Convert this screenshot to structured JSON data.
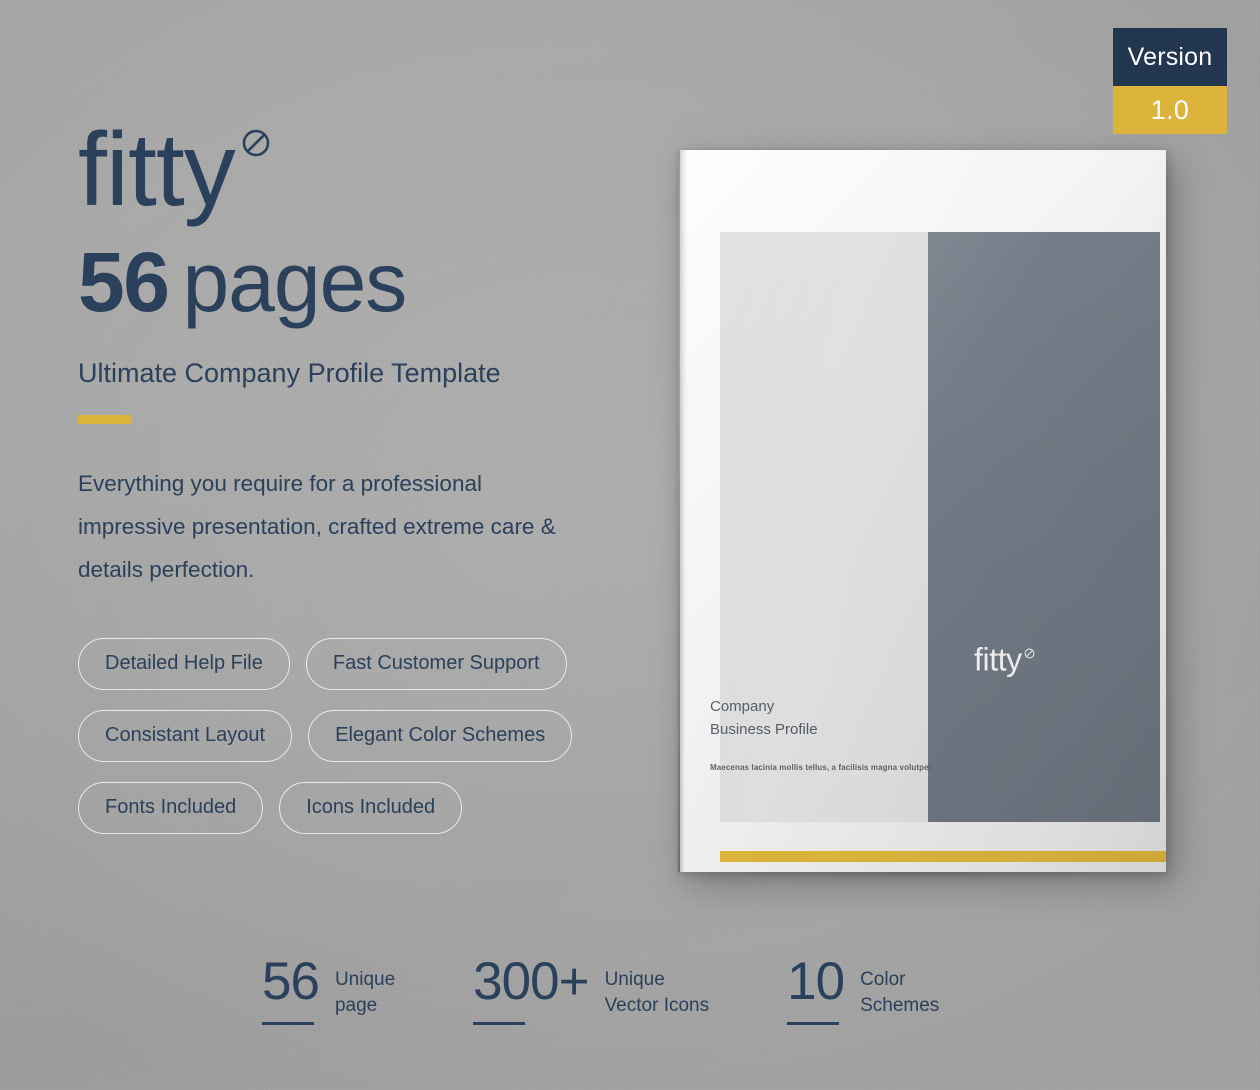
{
  "version_badge": {
    "label": "Version",
    "value": "1.0",
    "top_color": "#23364f",
    "bottom_color": "#dcb43c"
  },
  "brand": {
    "name": "fitty",
    "mark": "circle-slash-icon"
  },
  "headline": {
    "number": "56",
    "word": "pages"
  },
  "subtitle": "Ultimate Company Profile Template",
  "accent_color": "#dcb43c",
  "description": "Everything you require for a professional impressive presentation, crafted extreme care & details perfection.",
  "features": [
    "Detailed Help File",
    "Fast Customer Support",
    "Consistant Layout",
    "Elegant Color Schemes",
    "Fonts Included",
    "Icons Included"
  ],
  "stats": [
    {
      "number": "56",
      "line1": "Unique",
      "line2": "page"
    },
    {
      "number": "300+",
      "line1": "Unique",
      "line2": "Vector Icons"
    },
    {
      "number": "10",
      "line1": "Color",
      "line2": "Schemes"
    }
  ],
  "brochure": {
    "logo": "fitty",
    "company_line1": "Company",
    "company_line2": "Business Profile",
    "tagline": "Maecenas lacinia mollis tellus, a facilisis magna volutpet",
    "gold_bar_color": "#dcb43c",
    "dark_panel_color": "#6f7883",
    "light_panel_color": "#dcdcdc"
  },
  "theme": {
    "background": "#a9a9a9",
    "navy": "#2b405a",
    "gold": "#dcb43c"
  }
}
